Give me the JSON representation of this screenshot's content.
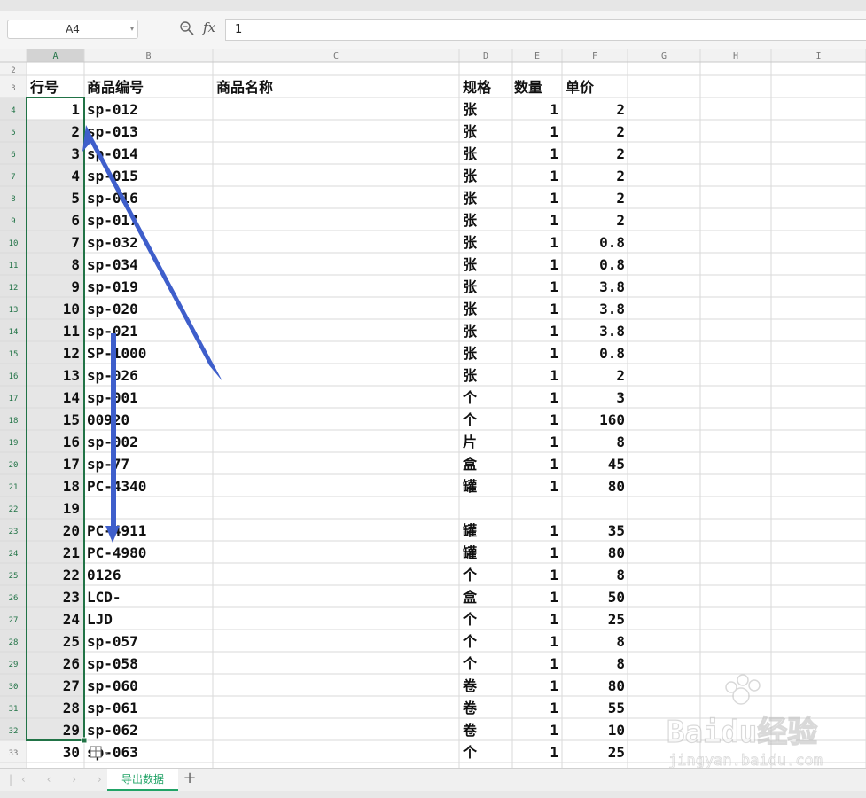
{
  "name_box": "A4",
  "formula_icon": "fx",
  "formula_value": "1",
  "column_headers": [
    "A",
    "B",
    "C",
    "D",
    "E",
    "F",
    "G",
    "H",
    "I"
  ],
  "first_row_number": 2,
  "header_row": {
    "row": "3",
    "cells": [
      "行号",
      "商品编号",
      "商品名称",
      "规格",
      "数量",
      "单价"
    ]
  },
  "rows": [
    {
      "n": "4",
      "a": "1",
      "b": "sp-012",
      "d": "张",
      "e": "1",
      "f": "2"
    },
    {
      "n": "5",
      "a": "2",
      "b": "sp-013",
      "d": "张",
      "e": "1",
      "f": "2"
    },
    {
      "n": "6",
      "a": "3",
      "b": "sp-014",
      "d": "张",
      "e": "1",
      "f": "2"
    },
    {
      "n": "7",
      "a": "4",
      "b": "sp-015",
      "d": "张",
      "e": "1",
      "f": "2"
    },
    {
      "n": "8",
      "a": "5",
      "b": "sp-016",
      "d": "张",
      "e": "1",
      "f": "2"
    },
    {
      "n": "9",
      "a": "6",
      "b": "sp-017",
      "d": "张",
      "e": "1",
      "f": "2"
    },
    {
      "n": "10",
      "a": "7",
      "b": "sp-032",
      "d": "张",
      "e": "1",
      "f": "0.8"
    },
    {
      "n": "11",
      "a": "8",
      "b": "sp-034",
      "d": "张",
      "e": "1",
      "f": "0.8"
    },
    {
      "n": "12",
      "a": "9",
      "b": "sp-019",
      "d": "张",
      "e": "1",
      "f": "3.8"
    },
    {
      "n": "13",
      "a": "10",
      "b": "sp-020",
      "d": "张",
      "e": "1",
      "f": "3.8"
    },
    {
      "n": "14",
      "a": "11",
      "b": "sp-021",
      "d": "张",
      "e": "1",
      "f": "3.8"
    },
    {
      "n": "15",
      "a": "12",
      "b": "SP-1000",
      "d": "张",
      "e": "1",
      "f": "0.8"
    },
    {
      "n": "16",
      "a": "13",
      "b": "sp-026",
      "d": "张",
      "e": "1",
      "f": "2"
    },
    {
      "n": "17",
      "a": "14",
      "b": "sp-001",
      "d": "个",
      "e": "1",
      "f": "3"
    },
    {
      "n": "18",
      "a": "15",
      "b": "00920",
      "d": "个",
      "e": "1",
      "f": "160"
    },
    {
      "n": "19",
      "a": "16",
      "b": "sp-002",
      "d": "片",
      "e": "1",
      "f": "8"
    },
    {
      "n": "20",
      "a": "17",
      "b": "sp-77",
      "d": "盒",
      "e": "1",
      "f": "45"
    },
    {
      "n": "21",
      "a": "18",
      "b": "PC-4340",
      "d": "罐",
      "e": "1",
      "f": "80"
    },
    {
      "n": "22",
      "a": "19",
      "b": "",
      "d": "",
      "e": "",
      "f": ""
    },
    {
      "n": "23",
      "a": "20",
      "b": "PC-4911",
      "d": "罐",
      "e": "1",
      "f": "35"
    },
    {
      "n": "24",
      "a": "21",
      "b": "PC-4980",
      "d": "罐",
      "e": "1",
      "f": "80"
    },
    {
      "n": "25",
      "a": "22",
      "b": "0126",
      "d": "个",
      "e": "1",
      "f": "8"
    },
    {
      "n": "26",
      "a": "23",
      "b": "LCD-",
      "d": "盒",
      "e": "1",
      "f": "50"
    },
    {
      "n": "27",
      "a": "24",
      "b": "LJD",
      "d": "个",
      "e": "1",
      "f": "25"
    },
    {
      "n": "28",
      "a": "25",
      "b": "sp-057",
      "d": "个",
      "e": "1",
      "f": "8"
    },
    {
      "n": "29",
      "a": "26",
      "b": "sp-058",
      "d": "个",
      "e": "1",
      "f": "8"
    },
    {
      "n": "30",
      "a": "27",
      "b": "sp-060",
      "d": "卷",
      "e": "1",
      "f": "80"
    },
    {
      "n": "31",
      "a": "28",
      "b": "sp-061",
      "d": "卷",
      "e": "1",
      "f": "55"
    },
    {
      "n": "32",
      "a": "29",
      "b": "sp-062",
      "d": "卷",
      "e": "1",
      "f": "10"
    },
    {
      "n": "33",
      "a": "30",
      "b": "sp-063",
      "d": "个",
      "e": "1",
      "f": "25"
    }
  ],
  "sheet_tab": "导出数据",
  "add_sheet_symbol": "+",
  "nav_arrows": "|‹ ‹ › ›|",
  "watermark": {
    "logo": "Baidu经验",
    "url": "jingyan.baidu.com"
  },
  "colors": {
    "selection": "#217346",
    "arrow": "#3e5ecb",
    "header_bg": "#f2f2f2",
    "selected_header_bg": "#d3d3d3",
    "grid": "#dadada"
  },
  "icons": {
    "zoom": "zoom-icon",
    "paste_options": "paste-options-icon"
  }
}
